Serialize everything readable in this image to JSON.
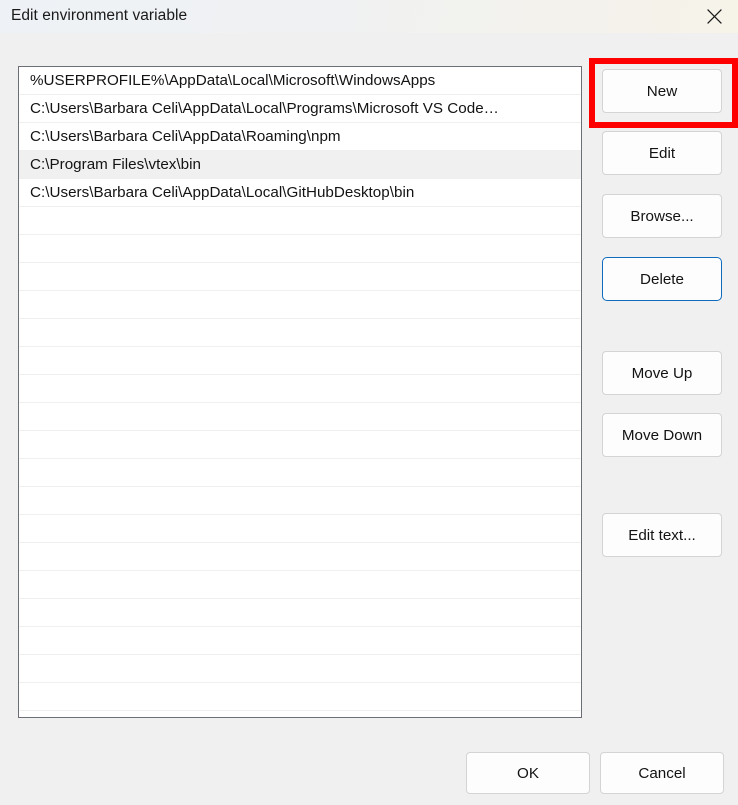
{
  "window": {
    "title": "Edit environment variable",
    "close_icon": "close-icon"
  },
  "path_list": {
    "entries": [
      {
        "text": "%USERPROFILE%\\AppData\\Local\\Microsoft\\WindowsApps",
        "selected": false
      },
      {
        "text": "C:\\Users\\Barbara Celi\\AppData\\Local\\Programs\\Microsoft VS Code…",
        "selected": false
      },
      {
        "text": "C:\\Users\\Barbara Celi\\AppData\\Roaming\\npm",
        "selected": false
      },
      {
        "text": "C:\\Program Files\\vtex\\bin",
        "selected": true
      },
      {
        "text": "C:\\Users\\Barbara Celi\\AppData\\Local\\GitHubDesktop\\bin",
        "selected": false
      }
    ],
    "empty_row_count": 18
  },
  "side_buttons": {
    "new": "New",
    "edit": "Edit",
    "browse": "Browse...",
    "delete": "Delete",
    "move_up": "Move Up",
    "move_down": "Move Down",
    "edit_text": "Edit text..."
  },
  "footer": {
    "ok": "OK",
    "cancel": "Cancel"
  },
  "annotation": {
    "target": "New",
    "color": "#ff0000"
  },
  "colors": {
    "dialog_background": "#f0f0f0",
    "listbox_background": "#ffffff",
    "listbox_border": "#6b6f76",
    "selected_row": "#f0f0f0",
    "button_face": "#fdfdfd",
    "button_border": "#d4d4d4",
    "focus_border": "#0f6cbd",
    "text": "#131313",
    "highlight": "#ff0000"
  }
}
